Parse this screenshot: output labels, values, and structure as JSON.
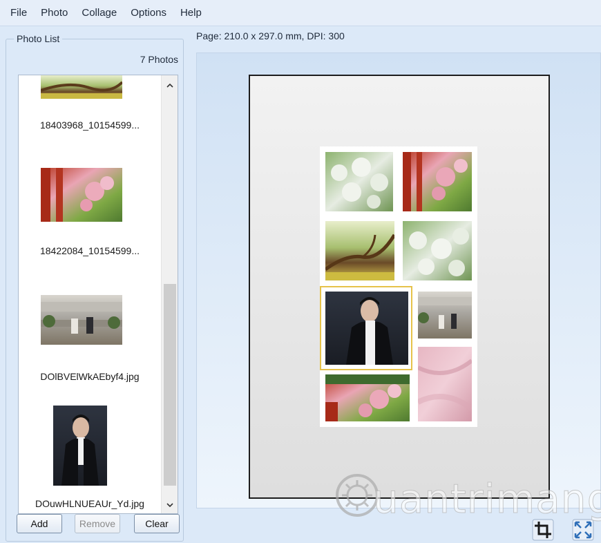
{
  "menu": [
    "File",
    "Photo",
    "Collage",
    "Options",
    "Help"
  ],
  "photo_list": {
    "title": "Photo List",
    "count_label": "7 Photos",
    "items": [
      {
        "caption": "18403968_10154599..."
      },
      {
        "caption": "18422084_10154599..."
      },
      {
        "caption": "DOlBVElWkAEbyf4.jpg"
      },
      {
        "caption": "DOuwHLNUEAUr_Yd.jpg"
      }
    ]
  },
  "buttons": {
    "add": "Add",
    "remove": "Remove",
    "clear": "Clear"
  },
  "page_info": "Page: 210.0 x 297.0 mm, DPI: 300",
  "watermark": "uantrimang",
  "colors": {
    "selection": "#e6c24a",
    "background": "#dce9f8"
  }
}
